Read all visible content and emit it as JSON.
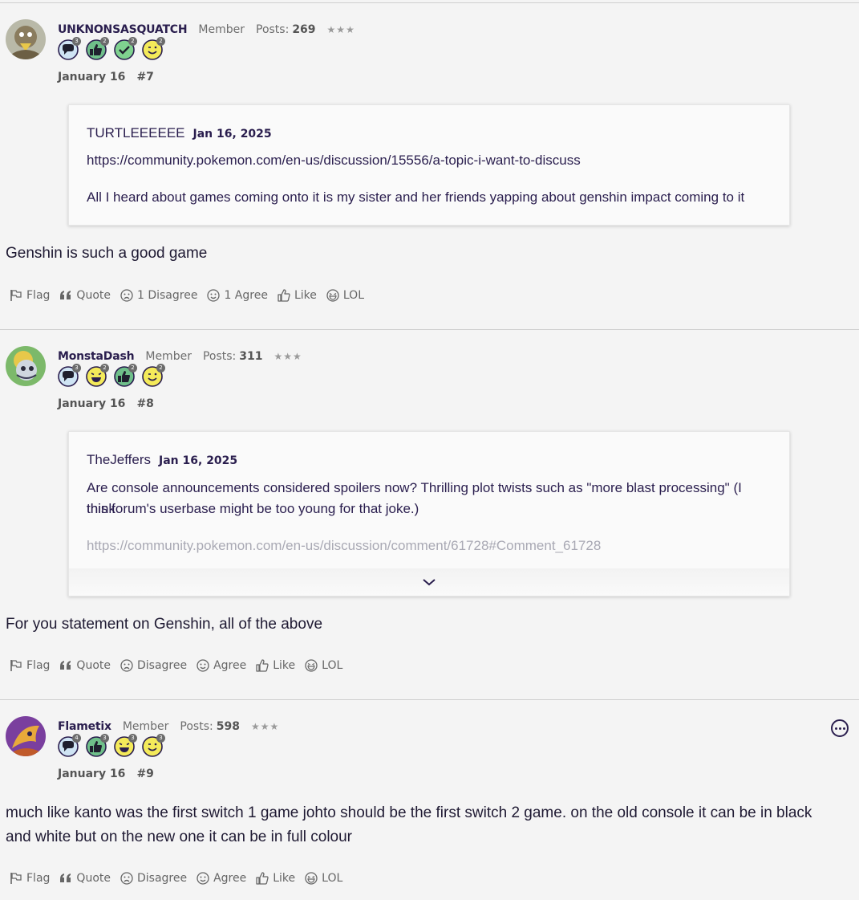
{
  "posts": [
    {
      "author": "UNKNONSASQUATCH",
      "role": "Member",
      "posts_label": "Posts:",
      "posts_count": "269",
      "stars": "★★★",
      "date": "January 16",
      "number": "#7",
      "avatar_color": "#8a8f7a",
      "badges": [
        {
          "icon": "comment-badge-icon",
          "count": "3"
        },
        {
          "icon": "thumbs-up-badge-icon",
          "count": "2"
        },
        {
          "icon": "checkmark-badge-icon",
          "count": "2"
        },
        {
          "icon": "wink-badge-icon",
          "count": "2"
        }
      ],
      "quote": {
        "author": "TURTLEEEEEE",
        "date": "Jan 16, 2025",
        "lines": [
          "https://community.pokemon.com/en-us/discussion/15556/a-topic-i-want-to-discuss",
          "All I heard about games coming onto it is my sister and her friends yapping about genshin impact coming to it"
        ]
      },
      "body": "Genshin is such a good game",
      "actions": {
        "flag": "Flag",
        "quote": "Quote",
        "disagree": "1 Disagree",
        "agree": "1 Agree",
        "like": "Like",
        "lol": "LOL"
      }
    },
    {
      "author": "MonstaDash",
      "role": "Member",
      "posts_label": "Posts:",
      "posts_count": "311",
      "stars": "★★★",
      "date": "January 16",
      "number": "#8",
      "avatar_color": "#6fae5c",
      "badges": [
        {
          "icon": "comment-badge-icon",
          "count": "3"
        },
        {
          "icon": "laugh-badge-icon",
          "count": "2"
        },
        {
          "icon": "thumbs-up-badge-icon",
          "count": "2"
        },
        {
          "icon": "wink-badge-icon",
          "count": "2"
        }
      ],
      "quote": {
        "author": "TheJeffers",
        "date": "Jan 16, 2025",
        "lines": [
          "Are console announcements considered spoilers now? Thrilling plot twists such as \"more blast processing\" (I think",
          "this forum's userbase might be too young for that joke.)",
          "https://community.pokemon.com/en-us/discussion/comment/61728#Comment_61728"
        ]
      },
      "body": "For you statement on Genshin, all of the above",
      "actions": {
        "flag": "Flag",
        "quote": "Quote",
        "disagree": "Disagree",
        "agree": "Agree",
        "like": "Like",
        "lol": "LOL"
      }
    },
    {
      "author": "Flametix",
      "role": "Member",
      "posts_label": "Posts:",
      "posts_count": "598",
      "stars": "★★★",
      "date": "January 16",
      "number": "#9",
      "avatar_color": "#7a3f9e",
      "badges": [
        {
          "icon": "comment-badge-icon",
          "count": "4"
        },
        {
          "icon": "thumbs-up-badge-icon",
          "count": "3"
        },
        {
          "icon": "laugh-badge-icon",
          "count": "3"
        },
        {
          "icon": "wink-badge-icon",
          "count": "3"
        }
      ],
      "body_lines": [
        "much like kanto was the first switch 1 game johto should be the first switch 2 game. on the old console it can be in black",
        "and white but on the new one it can be in full colour"
      ],
      "actions": {
        "flag": "Flag",
        "quote": "Quote",
        "disagree": "Disagree",
        "agree": "Agree",
        "like": "Like",
        "lol": "LOL"
      }
    }
  ]
}
